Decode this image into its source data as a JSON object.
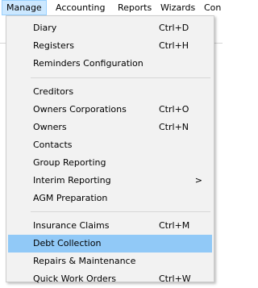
{
  "menubar": {
    "items": [
      {
        "label": "Manage"
      },
      {
        "label": "Accounting"
      },
      {
        "label": "Reports"
      },
      {
        "label": "Wizards"
      },
      {
        "label": "Con"
      }
    ]
  },
  "menu": {
    "items": [
      {
        "label": "Diary",
        "shortcut": "Ctrl+D"
      },
      {
        "label": "Registers",
        "shortcut": "Ctrl+H"
      },
      {
        "label": "Reminders Configuration",
        "shortcut": ""
      },
      {
        "label": "Creditors",
        "shortcut": ""
      },
      {
        "label": "Owners Corporations",
        "shortcut": "Ctrl+O"
      },
      {
        "label": "Owners",
        "shortcut": "Ctrl+N"
      },
      {
        "label": "Contacts",
        "shortcut": ""
      },
      {
        "label": "Group Reporting",
        "shortcut": ""
      },
      {
        "label": "Interim Reporting",
        "shortcut": "",
        "submenu_glyph": ">"
      },
      {
        "label": "AGM Preparation",
        "shortcut": ""
      },
      {
        "label": "Insurance Claims",
        "shortcut": "Ctrl+M"
      },
      {
        "label": "Debt Collection",
        "shortcut": ""
      },
      {
        "label": "Repairs & Maintenance",
        "shortcut": ""
      },
      {
        "label": "Quick Work Orders",
        "shortcut": "Ctrl+W"
      }
    ]
  },
  "colors": {
    "active_menubar_bg": "#cce8ff",
    "highlight_bg": "#91c9f7",
    "menu_bg": "#f2f2f2"
  }
}
